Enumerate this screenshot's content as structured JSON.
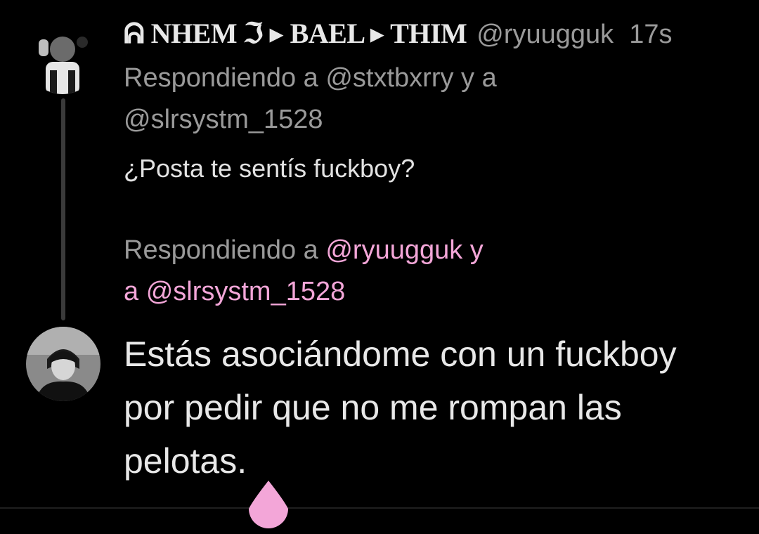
{
  "tweet1": {
    "display_name": "ᕱ NHEM ℑ ▸ BAEL ▸ THIM",
    "handle": "@ryuugguk",
    "time": "17s",
    "replying_line1": "Respondiendo a @stxtbxrry y a",
    "replying_line2": "@slrsystm_1528",
    "text": "¿Posta te sentís fuckboy?"
  },
  "compose": {
    "replying_prefix": "Respondiendo a ",
    "replying_mention1": "@ryuugguk y",
    "replying_line2": "a @slrsystm_1528",
    "text_line1": "Estás asociándome con un fuckboy",
    "text_line2": "por pedir que no me rompan las",
    "text_line3": "pelotas."
  },
  "colors": {
    "background": "#000000",
    "accent_pink": "#f3a6d8",
    "muted": "#9a9a9a",
    "text": "#e8e8e8"
  }
}
